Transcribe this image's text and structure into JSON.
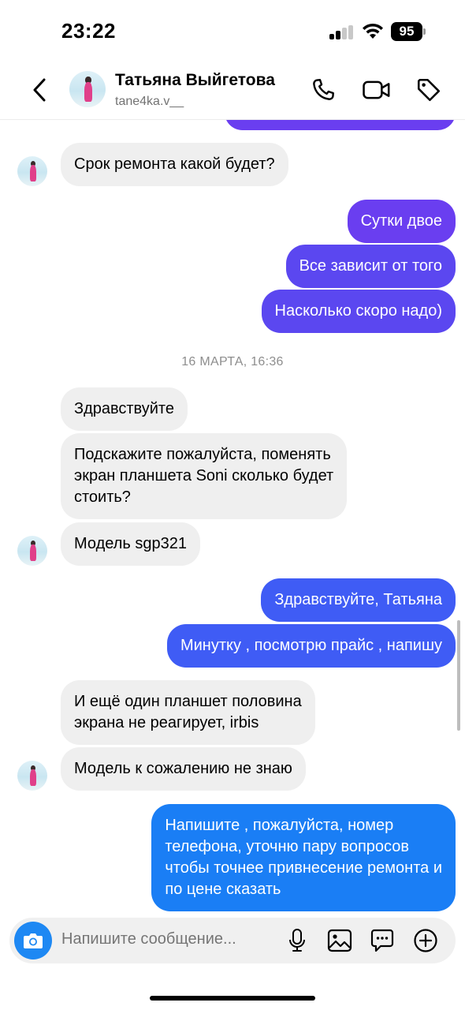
{
  "status_bar": {
    "time": "23:22",
    "battery": "95"
  },
  "header": {
    "name": "Татьяна Выйгетова",
    "username": "tane4ka.v__",
    "icons": [
      "back-chevron-icon",
      "phone-icon",
      "video-camera-icon",
      "tag-icon"
    ]
  },
  "messages": [
    {
      "id": "m1",
      "from": "contact",
      "text": "Срок ремонта какой будет?"
    },
    {
      "id": "m2",
      "from": "me",
      "text": "Сутки двое"
    },
    {
      "id": "m3",
      "from": "me",
      "text": "Все зависит от того"
    },
    {
      "id": "m4",
      "from": "me",
      "text": "Насколько скоро надо)"
    },
    {
      "id": "m5",
      "from": "contact",
      "text": "Здравствуйте"
    },
    {
      "id": "m6",
      "from": "contact",
      "lines": [
        "Подскажите пожалуйста, поменять",
        "экран планшета Soni сколько будет",
        "стоить?"
      ]
    },
    {
      "id": "m7",
      "from": "contact",
      "text": "Модель sgp321"
    },
    {
      "id": "m8",
      "from": "me",
      "text": "Здравствуйте, Татьяна"
    },
    {
      "id": "m9",
      "from": "me",
      "text": "Минутку , посмотрю прайс , напишу"
    },
    {
      "id": "m10",
      "from": "contact",
      "lines": [
        "И ещё один планшет половина",
        "экрана не реагирует, irbis"
      ]
    },
    {
      "id": "m11",
      "from": "contact",
      "text": "Модель к сожалению не знаю"
    },
    {
      "id": "m12",
      "from": "me",
      "lines": [
        "Напишите , пожалуйста, номер",
        "телефона, уточню пару вопросов",
        "чтобы точнее привнесение ремонта и",
        "по цене сказать"
      ]
    }
  ],
  "date_separator": "16 МАРТА, 16:36",
  "composer": {
    "placeholder": "Напишите сообщение...",
    "icons": [
      "camera-icon",
      "microphone-icon",
      "gallery-icon",
      "sticker-icon",
      "plus-icon"
    ]
  },
  "colors": {
    "outgoing_purple": "#6a3ef0",
    "outgoing_blue": "#1a7ef5",
    "incoming": "#efefef",
    "camera_button": "#1e88f3"
  }
}
